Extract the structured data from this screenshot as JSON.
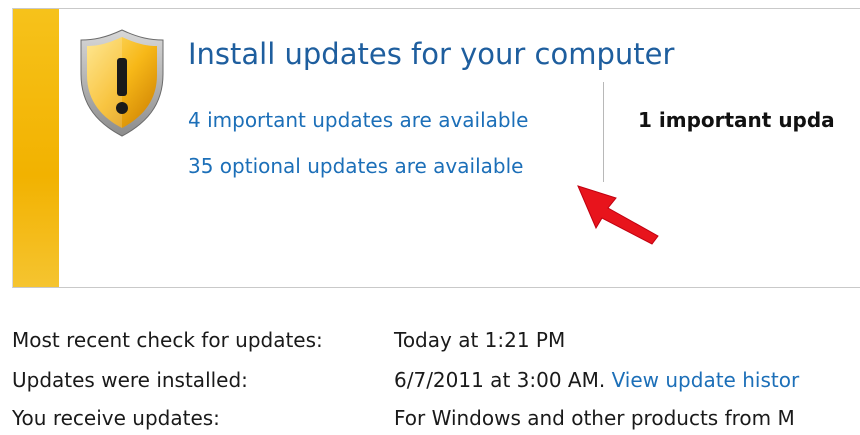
{
  "colors": {
    "accent_stripe": "#f2b200",
    "title": "#1e5e9e",
    "link": "#1c6fb8",
    "annotation_arrow": "#e8141c"
  },
  "panel": {
    "icon": "warning-shield-icon",
    "title": "Install updates for your computer",
    "important_link": "4 important updates are available",
    "optional_link": "35 optional updates are available",
    "selected_summary": "1 important upda"
  },
  "annotation": {
    "icon": "red-arrow-icon"
  },
  "info": {
    "recent_check_label": "Most recent check for updates:",
    "recent_check_value": "Today at 1:21 PM",
    "installed_label": "Updates were installed:",
    "installed_value": "6/7/2011 at 3:00 AM.",
    "history_link": "View update histor",
    "receive_label": "You receive updates:",
    "receive_value": "For Windows and other products from M"
  }
}
